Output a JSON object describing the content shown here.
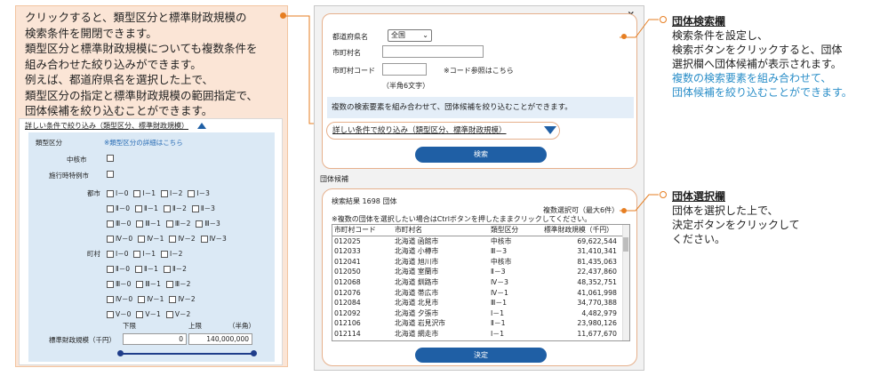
{
  "left": {
    "description_lines": [
      "クリックすると、類型区分と標準財政規模の",
      "検索条件を開閉できます。",
      "類型区分と標準財政規模についても複数条件を",
      "組み合わせた絞り込みができます。",
      "例えば、都道府県名を選択した上で、",
      "類型区分の指定と標準財政規模の範囲指定で、",
      "団体候補を絞り込むことができます。"
    ],
    "detail_toggle_label": "詳しい条件で絞り込み（類型区分、標準財政規模）",
    "type_label": "類型区分",
    "type_link": "※類型区分の詳細はこちら",
    "chukakushi": "中核市",
    "shikoji": "施行時特例市",
    "city_label": "都市",
    "town_label": "町村",
    "city_rows": [
      [
        "Ⅰ－0",
        "Ⅰ－1",
        "Ⅰ－2",
        "Ⅰ－3"
      ],
      [
        "Ⅱ－0",
        "Ⅱ－1",
        "Ⅱ－2",
        "Ⅱ－3"
      ],
      [
        "Ⅲ－0",
        "Ⅲ－1",
        "Ⅲ－2",
        "Ⅲ－3"
      ],
      [
        "Ⅳ－0",
        "Ⅳ－1",
        "Ⅳ－2",
        "Ⅳ－3"
      ]
    ],
    "town_rows": [
      [
        "Ⅰ－0",
        "Ⅰ－1",
        "Ⅰ－2"
      ],
      [
        "Ⅱ－0",
        "Ⅱ－1",
        "Ⅱ－2"
      ],
      [
        "Ⅲ－0",
        "Ⅲ－1",
        "Ⅲ－2"
      ],
      [
        "Ⅳ－0",
        "Ⅳ－1",
        "Ⅳ－2"
      ],
      [
        "Ⅴ－0",
        "Ⅴ－1",
        "Ⅴ－2"
      ]
    ],
    "lower_label": "下限",
    "upper_label": "上限",
    "halfwidth_label": "（半角）",
    "scale_label": "標準財政規模（千円）",
    "lower_value": "0",
    "upper_value": "140,000,000"
  },
  "mock": {
    "close": "×",
    "pref_label": "都道府県名",
    "pref_value": "全国",
    "muni_label": "市町村名",
    "code_label": "市町村コード",
    "code_hint": "（半角6文字）",
    "code_link": "※コード参照はこちら",
    "banner": "複数の検索要素を組み合わせて、団体候補を絞り込むことができます。",
    "detail_button": "詳しい条件で絞り込み（類型区分、標準財政規模）",
    "search_button": "検索",
    "candidates_label": "団体候補",
    "result_count": "検索結果 1698 団体",
    "multi_select": "複数選択可（最大6件）",
    "ctrl_note": "※複数の団体を選択したい場合はCtrlボタンを押したままクリックしてください。",
    "columns": [
      "市町村コード",
      "市町村名",
      "類型区分",
      "標準財政規模（千円）"
    ],
    "rows": [
      [
        "012025",
        "北海道 函館市",
        "中核市",
        "69,622,544"
      ],
      [
        "012033",
        "北海道 小樽市",
        "Ⅲ－3",
        "31,410,341"
      ],
      [
        "012041",
        "北海道 旭川市",
        "中核市",
        "81,435,063"
      ],
      [
        "012050",
        "北海道 室蘭市",
        "Ⅱ－3",
        "22,437,860"
      ],
      [
        "012068",
        "北海道 釧路市",
        "Ⅳ－3",
        "48,352,751"
      ],
      [
        "012076",
        "北海道 帯広市",
        "Ⅳ－1",
        "41,061,998"
      ],
      [
        "012084",
        "北海道 北見市",
        "Ⅲ－1",
        "34,770,388"
      ],
      [
        "012092",
        "北海道 夕張市",
        "Ⅰ－1",
        "4,482,979"
      ],
      [
        "012106",
        "北海道 岩見沢市",
        "Ⅱ－1",
        "23,980,126"
      ],
      [
        "012114",
        "北海道 網走市",
        "Ⅰ－1",
        "11,677,670"
      ]
    ],
    "decide_button": "決定"
  },
  "annotations": {
    "search_title": "団体検索欄",
    "search_lines": [
      "検索条件を設定し、",
      "検索ボタンをクリックすると、団体",
      "選択欄へ団体候補が表示されます。"
    ],
    "search_blue_lines": [
      "複数の検索要素を組み合わせて、",
      "団体候補を絞り込むことができます。"
    ],
    "select_title": "団体選択欄",
    "select_lines": [
      "団体を選択した上で、",
      "決定ボタンをクリックして",
      "ください。"
    ]
  },
  "colors": {
    "accent_orange": "#e67e22",
    "button_blue": "#1f5fa5",
    "link_blue": "#2a6db5",
    "panel_peach": "#fbe5d6",
    "panel_lightblue": "#dbe9f5"
  }
}
